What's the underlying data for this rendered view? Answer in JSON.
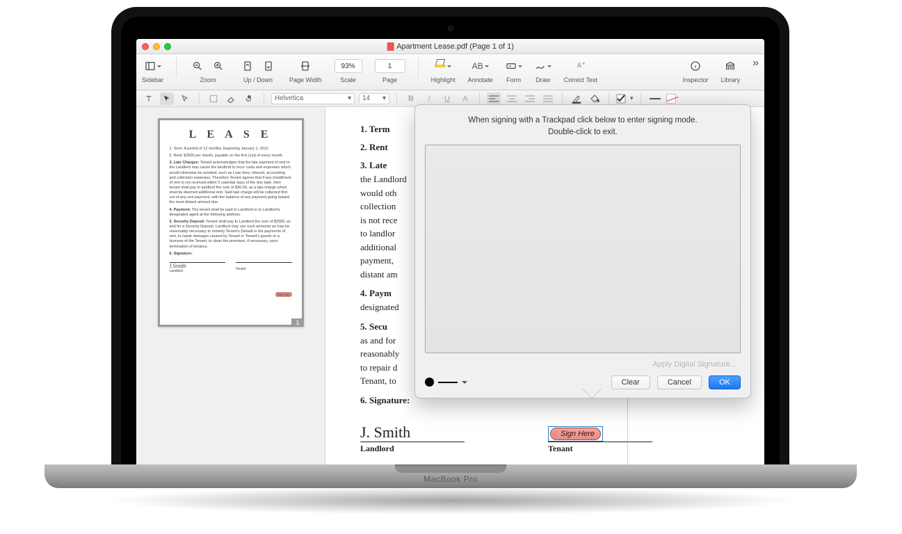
{
  "window": {
    "title": "Apartment Lease.pdf (Page 1 of 1)"
  },
  "laptop_label": "MacBook Pro",
  "toolbar": {
    "sidebar": "Sidebar",
    "zoom": "Zoom",
    "updown": "Up / Down",
    "page_width": "Page Width",
    "scale": "Scale",
    "scale_value": "93%",
    "page": "Page",
    "page_value": "1",
    "highlight": "Highlight",
    "annotate": "Annotate",
    "form": "Form",
    "draw": "Draw",
    "correct": "Correct Text",
    "inspector": "Inspector",
    "library": "Library"
  },
  "formatbar": {
    "font": "Helvetica",
    "size": "14"
  },
  "thumbnail": {
    "page_number": "1",
    "title": "L E A S E",
    "term": "1. Term: A period of 12 months, beginning January 1, 2012",
    "rent": "2. Rent: $2500 per month, payable on the first (1st) of every month.",
    "late_h": "3. Late Charges:",
    "late": " Tenant acknowledges that the late payment of rent to the Landlord may cause the landlord to incur costs and expenses which would otherwise be avoided, such as Loan fees, interest, accounting and collection expenses. Therefore Tenant agrees that if any installment of rent is not received within 5 calendar days of the due date, then tenant shall pay to landlord the sum of $30.00, as a late charge which shall be deemed additional rent. Said late charge will be collected first out of any rent payment, with the balance of any payment going toward the most distant amount due.",
    "payment_h": "4. Payment:",
    "payment": " The tenant shall be paid to Landlord or to Landlord's designated agent at the following address.",
    "deposit_h": "5. Security Deposit:",
    "deposit": " Tenant shall pay to Landlord the sum of $2500, as and for a Security Deposit. Landlord may use such amounts as may be reasonably necessary to remedy Tenant's Default in the payments of rent, to repair damages caused by Tenant or Tenant's guests or a licensee of the Tenant, to clean the premises, if necessary, upon termination of tenancy.",
    "sig_h": "6. Signature:",
    "landlord": "Landlord",
    "tenant": "Tenant",
    "sign_here": "Sign Here"
  },
  "document": {
    "sec1": "1. Term",
    "sec2": "2. Rent",
    "sec3": "3.  Late",
    "sec3_body": "the Landlord\nwould oth\ncollection\nis not rece\nto landlor\nadditional\npayment,\ndistant am",
    "sec4": "4. Paym",
    "sec4_body": "designated",
    "sec5": "5.  Secu",
    "sec5_body": "as and for\nreasonably\nto repair d\nTenant, to",
    "sec6": "6. Signature",
    "landlord_name": "J. Smith",
    "landlord_label": "Landlord",
    "tenant_label": "Tenant",
    "sign_here": "Sign Here"
  },
  "popover": {
    "instruction_line1": "When signing with a Trackpad click below to enter signing mode.",
    "instruction_line2": "Double-click to exit.",
    "apply_digital": "Apply Digital Signature...",
    "clear": "Clear",
    "cancel": "Cancel",
    "ok": "OK"
  }
}
